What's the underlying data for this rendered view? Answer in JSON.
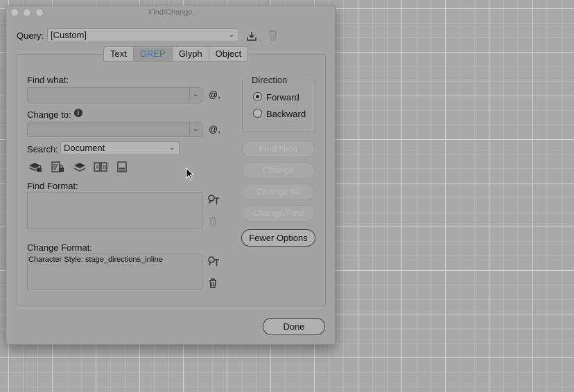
{
  "window": {
    "title": "Find/Change"
  },
  "query": {
    "label": "Query:",
    "value": "[Custom]"
  },
  "tabs": [
    {
      "label": "Text",
      "active": false
    },
    {
      "label": "GREP",
      "active": true
    },
    {
      "label": "Glyph",
      "active": false
    },
    {
      "label": "Object",
      "active": false
    }
  ],
  "find_what": {
    "label": "Find what:",
    "value": ""
  },
  "change_to": {
    "label": "Change to:",
    "value": ""
  },
  "search": {
    "label": "Search:",
    "value": "Document"
  },
  "find_format": {
    "label": "Find Format:",
    "value": ""
  },
  "change_format": {
    "label": "Change Format:",
    "value": "Character Style: stage_directions_inline"
  },
  "direction": {
    "label": "Direction",
    "options": [
      {
        "label": "Forward",
        "selected": true
      },
      {
        "label": "Backward",
        "selected": false
      }
    ]
  },
  "buttons": {
    "find_next": "Find Next",
    "change": "Change",
    "change_all": "Change All",
    "change_find": "Change/Find",
    "fewer_options": "Fewer Options",
    "done": "Done"
  },
  "special_char_symbol": "@,",
  "icons": {
    "save_query": "save-query-icon",
    "delete_query": "trash-icon",
    "special_chars": "at-symbol-icon",
    "include_locked_layers": "locked-layers-icon",
    "include_locked_stories": "locked-stories-icon",
    "include_hidden_layers": "hidden-layers-icon",
    "include_master_pages": "master-pages-icon",
    "include_footnotes": "footnotes-icon",
    "specify_format": "format-search-icon",
    "clear_format": "trash-icon"
  },
  "colors": {
    "active_tab_text": "#3a6fb0",
    "dialog_bg": "#a3a3a3"
  }
}
